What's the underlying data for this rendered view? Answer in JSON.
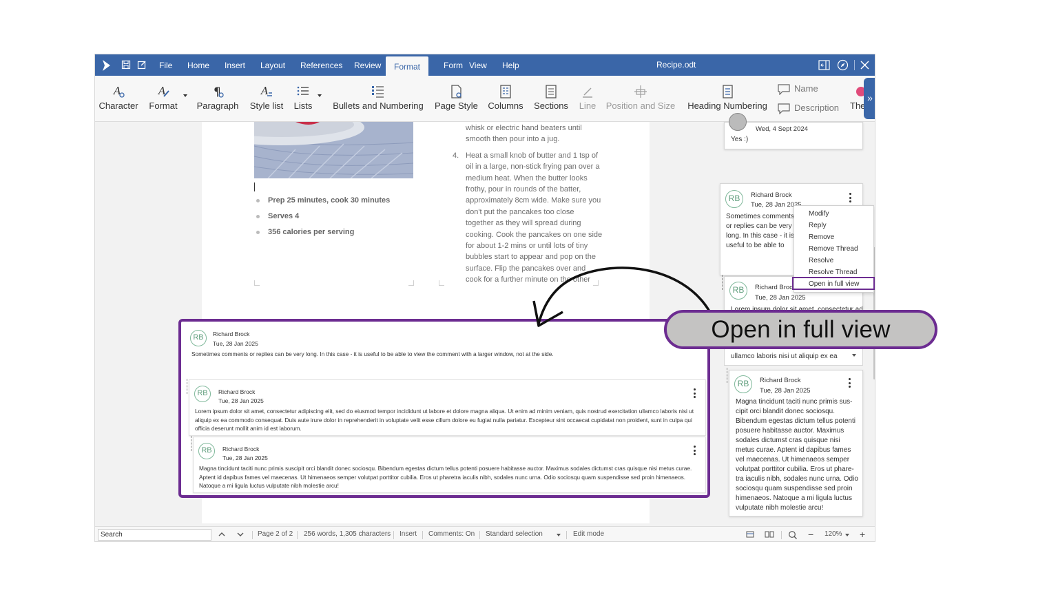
{
  "app": {
    "doc_title": "Recipe.odt",
    "menus": [
      "File",
      "Home",
      "Insert",
      "Layout",
      "References",
      "Review",
      "Format",
      "Form",
      "View",
      "Help"
    ],
    "active_menu": "Format"
  },
  "ribbon": {
    "character": "Character",
    "format": "Format",
    "paragraph": "Paragraph",
    "style_list": "Style list",
    "lists": "Lists",
    "bullets_numbering": "Bullets and Numbering",
    "page_style": "Page Style",
    "columns": "Columns",
    "sections": "Sections",
    "line": "Line",
    "position_size": "Position and Size",
    "heading_numbering": "Heading Numbering",
    "name": "Name",
    "description": "Description",
    "theme_partial": "The",
    "expand": "»"
  },
  "document": {
    "bullets": [
      "Prep 25 minutes, cook 30 minutes",
      "Serves 4",
      "356 calories per serving"
    ],
    "text_intro": "whisk or electric hand beaters until smooth then pour into a jug.",
    "step_num": "4.",
    "step_text": "Heat a small knob of butter and 1 tsp of oil in a large, non-stick frying pan over a medium heat. When the butter looks frothy, pour in rounds of the batter, approximately 8cm wide. Make sure you don't put the pancakes too close together as they will spread during cooking. Cook the pancakes on one side for about 1-2 mins or until lots of tiny bubbles start to appear and pop on the surface. Flip the pancakes over and cook for a further minute on the other"
  },
  "sidebar_comments": {
    "c0_date": "Wed, 4 Sept 2024",
    "c0_body": "Yes :)",
    "c1_author": "Richard Brock",
    "c1_date": "Tue, 28 Jan 2025",
    "c1_body": "Sometimes comments or replies can be very long. In this case - it is useful to be able to view the comment with a larger window, not at the side.",
    "c2_author": "Richard Brock",
    "c2_date": "Tue, 28 Jan 2025",
    "c2_body": "Lorem ipsum dolor sit amet, consectetur adipiscing elit",
    "c2_tail": "ullamco laboris nisi ut aliquip ex ea",
    "c3_author": "Richard Brock",
    "c3_date": "Tue, 28 Jan 2025",
    "c3_body": "Magna tincidunt taciti nunc primis sus-cipit orci blandit donec sociosqu. Bibendum egestas dictum tellus potenti posuere habitasse auctor. Maximus sodales dictumst cras quisque nisi metus curae. Aptent id dapibus fames vel maecenas. Ut himenaeos semper volutpat porttitor cubilia. Eros ut phare-tra iaculis nibh, sodales nunc urna. Odio sociosqu quam suspendisse sed proin himenaeos. Natoque a mi ligula luctus vulputate nibh molestie arcu!",
    "initials": "RB"
  },
  "context_menu": {
    "items": [
      "Modify",
      "Reply",
      "Remove",
      "Remove Thread",
      "Resolve",
      "Resolve Thread",
      "Open in full view"
    ]
  },
  "full_view": {
    "initials": "RB",
    "a1": "Richard Brock",
    "d1": "Tue, 28 Jan 2025",
    "b1": "Sometimes comments or replies can be very long. In this case - it is useful to be able to view the comment with a larger window, not at the side.",
    "a2": "Richard Brock",
    "d2": "Tue, 28 Jan 2025",
    "b2": "Lorem ipsum dolor sit amet, consectetur adipiscing elit, sed do eiusmod tempor incididunt ut labore et dolore magna aliqua. Ut enim ad minim veniam, quis nostrud exercitation ullamco laboris nisi ut aliquip ex ea commodo consequat. Duis aute irure dolor in reprehenderit in voluptate velit esse cillum dolore eu fugiat nulla pariatur. Excepteur sint occaecat cupidatat non proident, sunt in culpa qui officia deserunt mollit anim id est laborum.",
    "a3": "Richard Brock",
    "d3": "Tue, 28 Jan 2025",
    "b3": "Magna tincidunt taciti nunc primis suscipit orci blandit donec sociosqu. Bibendum egestas dictum tellus potenti posuere habitasse auctor. Maximus sodales dictumst cras quisque nisi metus curae. Aptent id dapibus fames vel maecenas. Ut himenaeos semper volutpat porttitor cubilia. Eros ut pharetra iaculis nibh, sodales nunc urna. Odio sociosqu quam suspendisse sed proin himenaeos. Natoque a mi ligula luctus vulputate nibh molestie arcu!"
  },
  "callout": "Open in full view",
  "status": {
    "search": "Search",
    "page": "Page 2 of 2",
    "words": "256 words, 1,305 characters",
    "insert": "Insert",
    "comments": "Comments: On",
    "selection": "Standard selection",
    "edit_mode": "Edit mode",
    "zoom": "120%"
  },
  "colors": {
    "accent": "#3a66a8",
    "highlight": "#6c2c91",
    "avatar": "#7fb89a"
  }
}
